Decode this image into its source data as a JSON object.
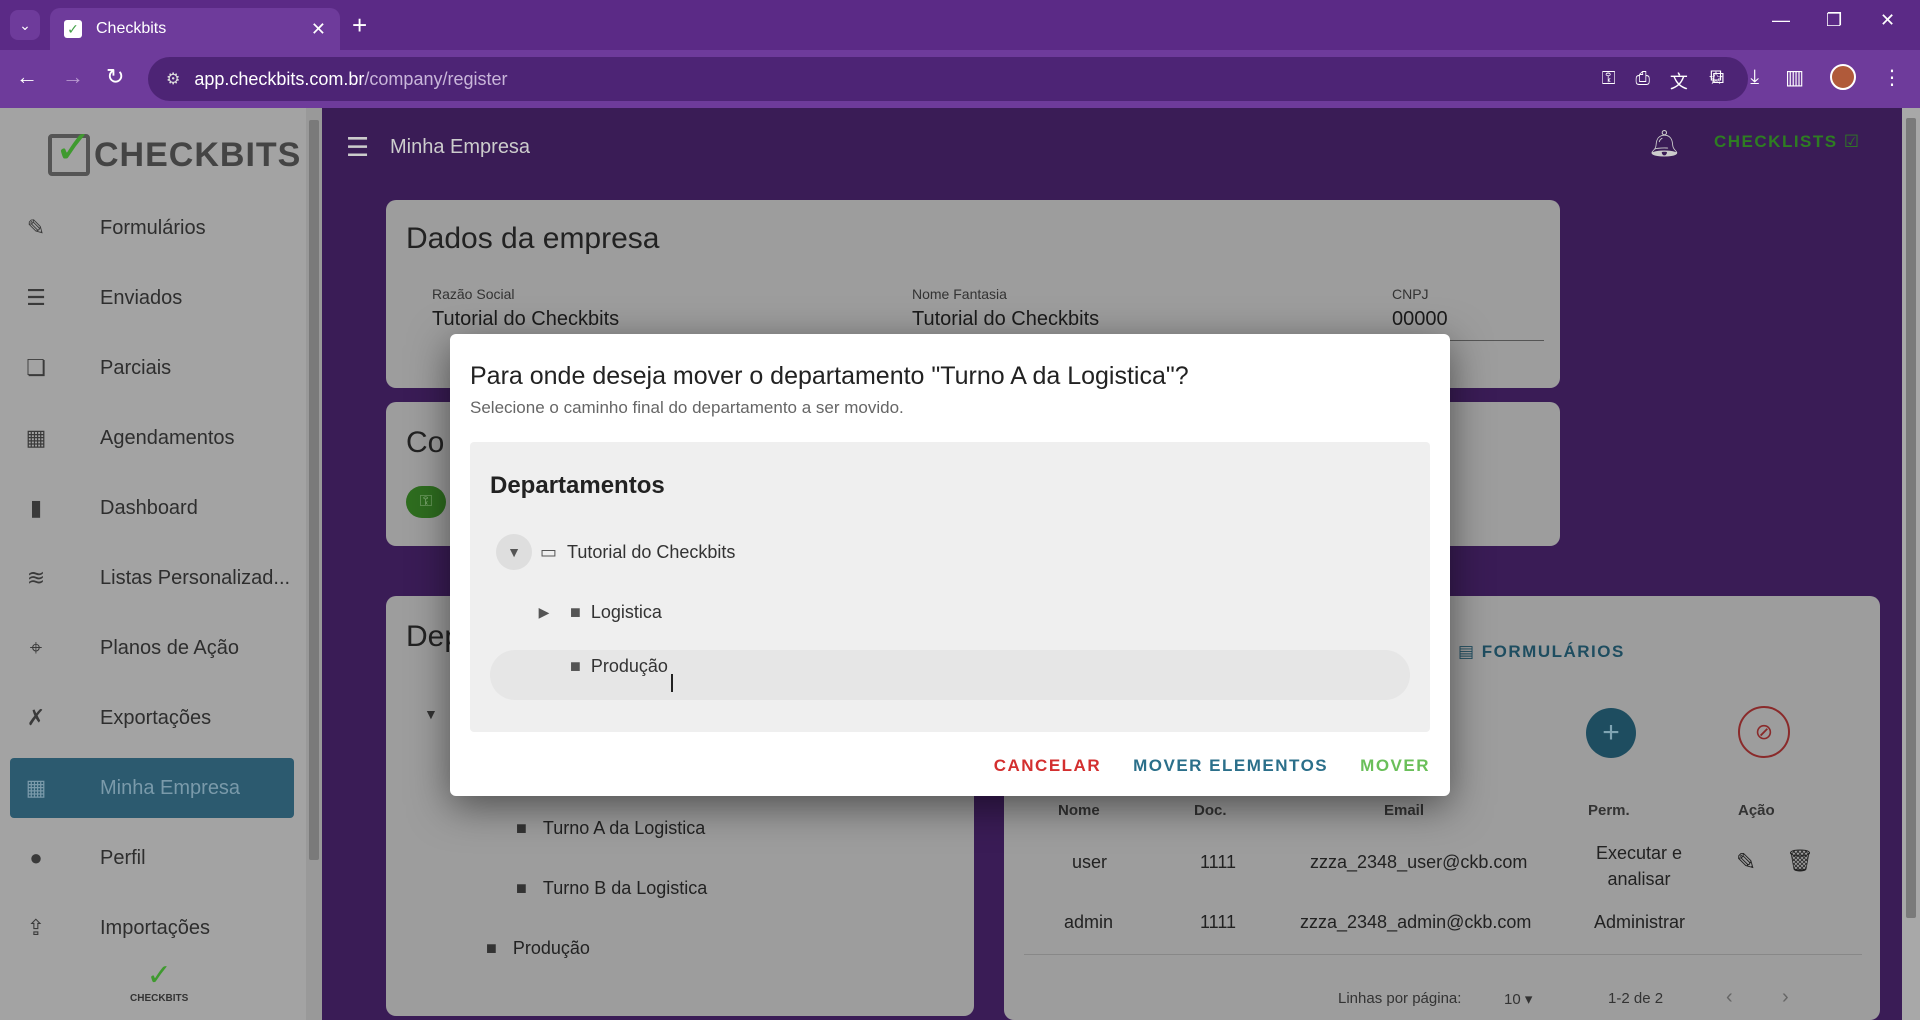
{
  "browser": {
    "tab_title": "Checkbits",
    "url_host": "app.checkbits.com.br",
    "url_path": "/company/register"
  },
  "sidebar": {
    "logo_text": "CHECKBITS",
    "mini_logo_text": "CHECKBITS",
    "items": [
      {
        "label": "Formulários",
        "icon": "form-icon"
      },
      {
        "label": "Enviados",
        "icon": "sent-icon"
      },
      {
        "label": "Parciais",
        "icon": "partial-icon"
      },
      {
        "label": "Agendamentos",
        "icon": "calendar-icon"
      },
      {
        "label": "Dashboard",
        "icon": "chart-icon"
      },
      {
        "label": "Listas Personalizad...",
        "icon": "layers-icon"
      },
      {
        "label": "Planos de Ação",
        "icon": "crosshair-icon"
      },
      {
        "label": "Exportações",
        "icon": "excel-icon"
      },
      {
        "label": "Minha Empresa",
        "icon": "building-icon",
        "active": true
      },
      {
        "label": "Perfil",
        "icon": "person-icon"
      },
      {
        "label": "Importações",
        "icon": "import-icon"
      }
    ]
  },
  "appbar": {
    "title": "Minha Empresa",
    "checklists_label": "CHECKLISTS"
  },
  "company": {
    "heading": "Dados da empresa",
    "razao_label": "Razão Social",
    "razao_value": "Tutorial do Checkbits",
    "fantasia_label": "Nome Fantasia",
    "fantasia_value": "Tutorial do Checkbits",
    "cnpj_label": "CNPJ",
    "cnpj_value": "00000"
  },
  "card2": {
    "heading_partial": "Co"
  },
  "departments_card": {
    "heading_partial": "Dep",
    "items": [
      "Turno A da Logistica",
      "Turno B da Logistica",
      "Produção"
    ]
  },
  "users": {
    "formularios_label": "FORMULÁRIOS",
    "columns": [
      "Nome",
      "Doc.",
      "Email",
      "Perm.",
      "Ação"
    ],
    "rows": [
      {
        "nome": "user",
        "doc": "1111",
        "email": "zzza_2348_user@ckb.com",
        "perm": "Executar e analisar"
      },
      {
        "nome": "admin",
        "doc": "1111",
        "email": "zzza_2348_admin@ckb.com",
        "perm": "Administrar"
      }
    ],
    "rows_per_page_label": "Linhas por página:",
    "rows_per_page": "10",
    "range": "1-2 de 2"
  },
  "modal": {
    "title": "Para onde deseja mover o departamento \"Turno A da Logistica\"?",
    "subtitle": "Selecione o caminho final do departamento a ser movido.",
    "tree_title": "Departamentos",
    "root": "Tutorial do Checkbits",
    "children": [
      "Logistica",
      "Produção"
    ],
    "cancel_label": "CANCELAR",
    "move_elements_label": "MOVER ELEMENTOS",
    "move_label": "MOVER"
  }
}
